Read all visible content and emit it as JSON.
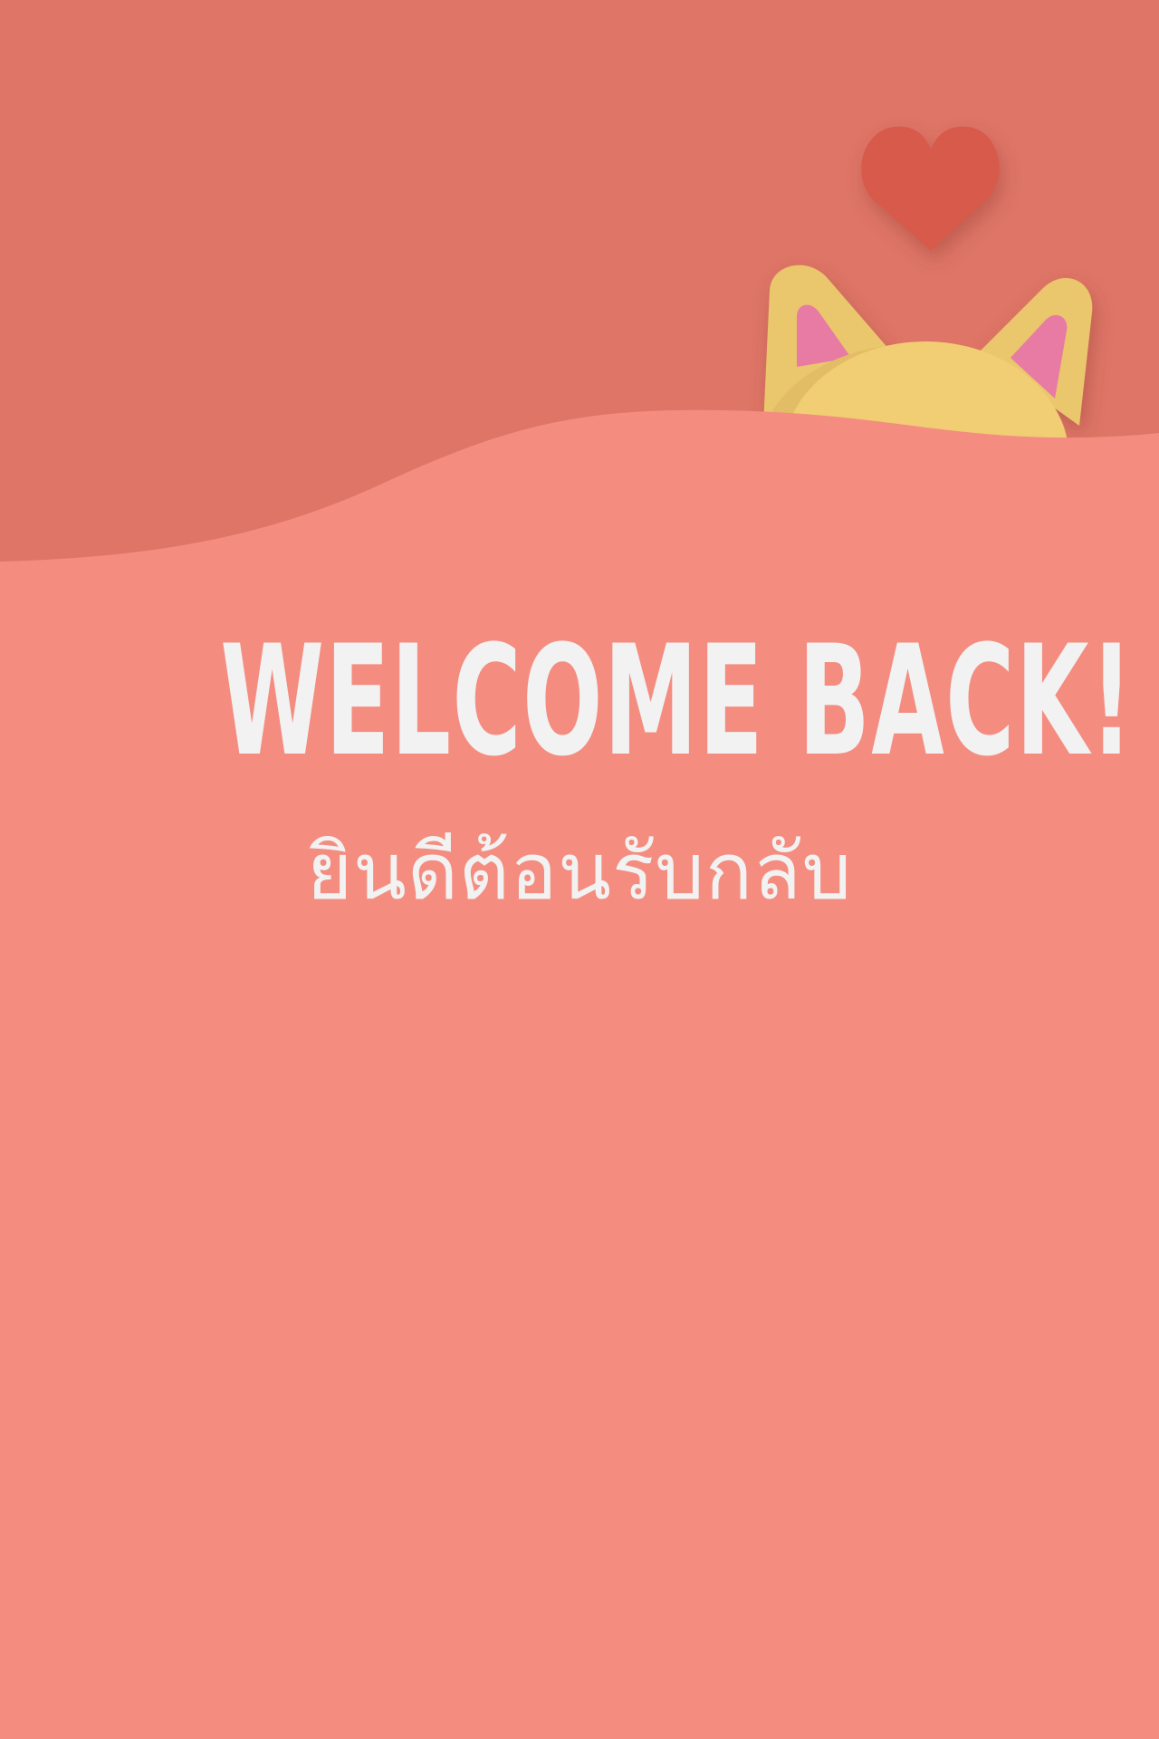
{
  "colors": {
    "top_background": "#de7567",
    "wave_background": "#f48d80",
    "text": "#f2f2f2",
    "heart": "#d85a4c",
    "cat_head": "#f1cd74",
    "cat_ear_outer": "#eac66c",
    "cat_ear_inner": "#e87ba4"
  },
  "icons": {
    "heart": "heart-icon",
    "cat": "cat-peek-illustration"
  },
  "welcome": {
    "title": "WELCOME  BACK!",
    "subtitle": "ยินดีต้อนรับกลับ"
  }
}
